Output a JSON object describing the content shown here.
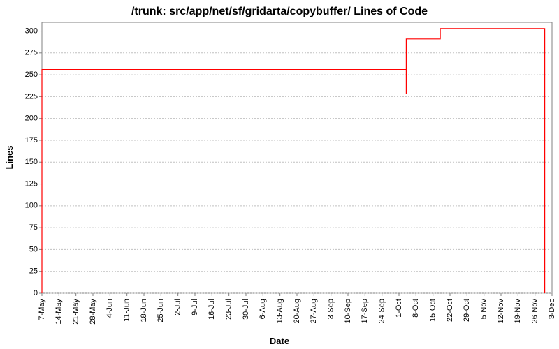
{
  "chart_data": {
    "type": "line",
    "title": "/trunk: src/app/net/sf/gridarta/copybuffer/ Lines of Code",
    "xlabel": "Date",
    "ylabel": "Lines",
    "ylim": [
      0,
      310
    ],
    "yticks": [
      0,
      25,
      50,
      75,
      100,
      125,
      150,
      175,
      200,
      225,
      250,
      275,
      300
    ],
    "categories": [
      "7-May",
      "14-May",
      "21-May",
      "28-May",
      "4-Jun",
      "11-Jun",
      "18-Jun",
      "25-Jun",
      "2-Jul",
      "9-Jul",
      "16-Jul",
      "23-Jul",
      "30-Jul",
      "6-Aug",
      "13-Aug",
      "20-Aug",
      "27-Aug",
      "3-Sep",
      "10-Sep",
      "17-Sep",
      "24-Sep",
      "1-Oct",
      "8-Oct",
      "15-Oct",
      "22-Oct",
      "29-Oct",
      "5-Nov",
      "12-Nov",
      "19-Nov",
      "26-Nov",
      "3-Dec"
    ],
    "series": [
      {
        "name": "Lines of Code",
        "color": "#ff0000",
        "points": [
          {
            "x": "7-May",
            "y": 0
          },
          {
            "x": "7-May",
            "y": 256
          },
          {
            "x": "4-Oct",
            "y": 256
          },
          {
            "x": "4-Oct",
            "y": 228
          },
          {
            "x": "4-Oct",
            "y": 291
          },
          {
            "x": "18-Oct",
            "y": 291
          },
          {
            "x": "18-Oct",
            "y": 303
          },
          {
            "x": "30-Nov",
            "y": 303
          },
          {
            "x": "30-Nov",
            "y": 0
          }
        ]
      }
    ]
  }
}
